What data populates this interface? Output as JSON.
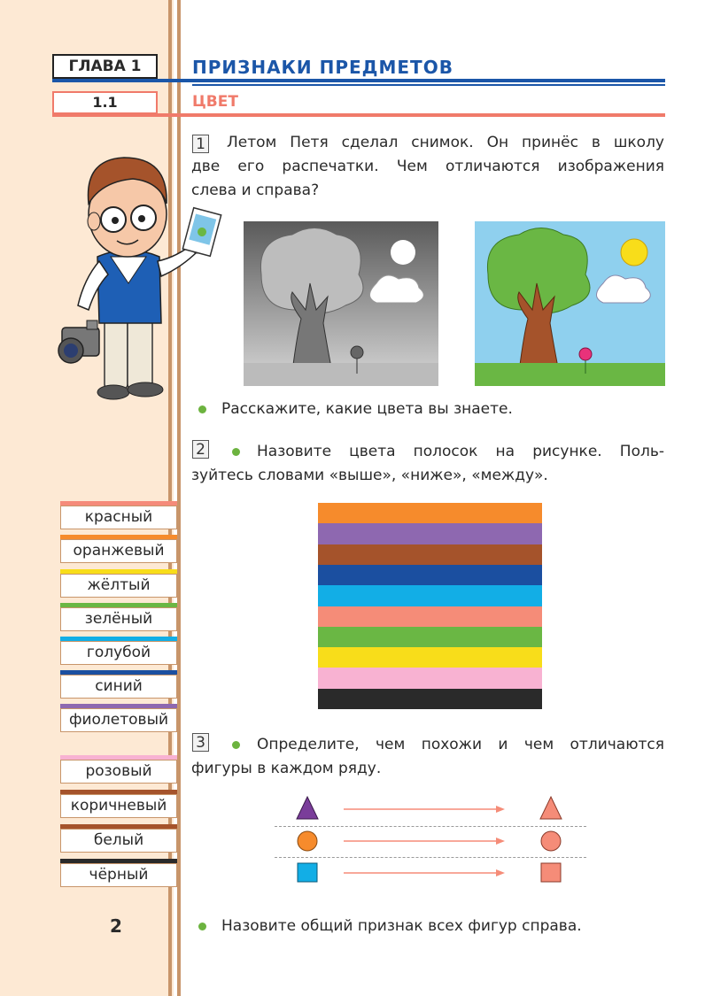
{
  "header": {
    "chapter_label": "ГЛАВА  1",
    "chapter_title": "ПРИЗНАКИ  ПРЕДМЕТОВ",
    "section_number": "1.1",
    "section_title": "ЦВЕТ"
  },
  "exercise1": {
    "number": "1",
    "line1": "Летом  Петя  сделал  снимок.  Он  принёс  в  школу",
    "line2": "две  его  распечатки.  Чем  отличаются  изображения",
    "line3": "слева  и  справа?",
    "question": "Расскажите,  какие  цвета  вы  знаете."
  },
  "exercise2": {
    "number": "2",
    "line1": "Назовите  цвета  полосок  на  рисунке.  Поль-",
    "line2": "зуйтесь  словами  «выше»,  «ниже»,  «между».",
    "stripes": [
      "#f68b2c",
      "#8e68b0",
      "#a5532b",
      "#1b4fa0",
      "#12aee6",
      "#f58c78",
      "#6ab744",
      "#f8dd1a",
      "#f8b2d2",
      "#2a2a2a"
    ]
  },
  "exercise3": {
    "number": "3",
    "line1": "Определите,  чем  похожи  и  чем  отличаются",
    "line2": "фигуры  в  каждом  ряду.",
    "question": "Назовите  общий  признак  всех  фигур  справа."
  },
  "colors": [
    {
      "label": "красный",
      "color": "#f58b7a"
    },
    {
      "label": "оранжевый",
      "color": "#f68b2c"
    },
    {
      "label": "жёлтый",
      "color": "#f8dd1a"
    },
    {
      "label": "зелёный",
      "color": "#6ab744"
    },
    {
      "label": "голубой",
      "color": "#12aee6"
    },
    {
      "label": "синий",
      "color": "#1b4fa0"
    },
    {
      "label": "фиолетовый",
      "color": "#8e68b0"
    },
    {
      "label": "розовый",
      "color": "#f8b2d2"
    },
    {
      "label": "коричневый",
      "color": "#a5532b"
    },
    {
      "label": "белый",
      "color": "#ffffff"
    },
    {
      "label": "чёрный",
      "color": "#2a2a2a"
    }
  ],
  "page_number": "2"
}
